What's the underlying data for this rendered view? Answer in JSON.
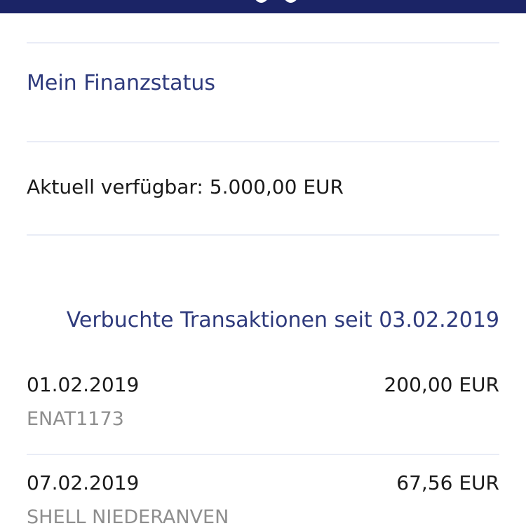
{
  "finance": {
    "section_title": "Mein Finanzstatus",
    "available_label": "Aktuell verfügbar: 5.000,00 EUR"
  },
  "transactions": {
    "heading": "Verbuchte Transaktionen seit 03.02.2019",
    "items": [
      {
        "date": "01.02.2019",
        "amount": "200,00 EUR",
        "description": "ENAT1173"
      },
      {
        "date": "07.02.2019",
        "amount": "67,56 EUR",
        "description": "SHELL NIEDERANVEN"
      }
    ]
  },
  "colors": {
    "header_bar": "#1b2466",
    "accent_text": "#2e3a7c",
    "primary_text": "#1a1a1a",
    "secondary_text": "#8e8e8e",
    "divider": "#e9ecf6"
  }
}
